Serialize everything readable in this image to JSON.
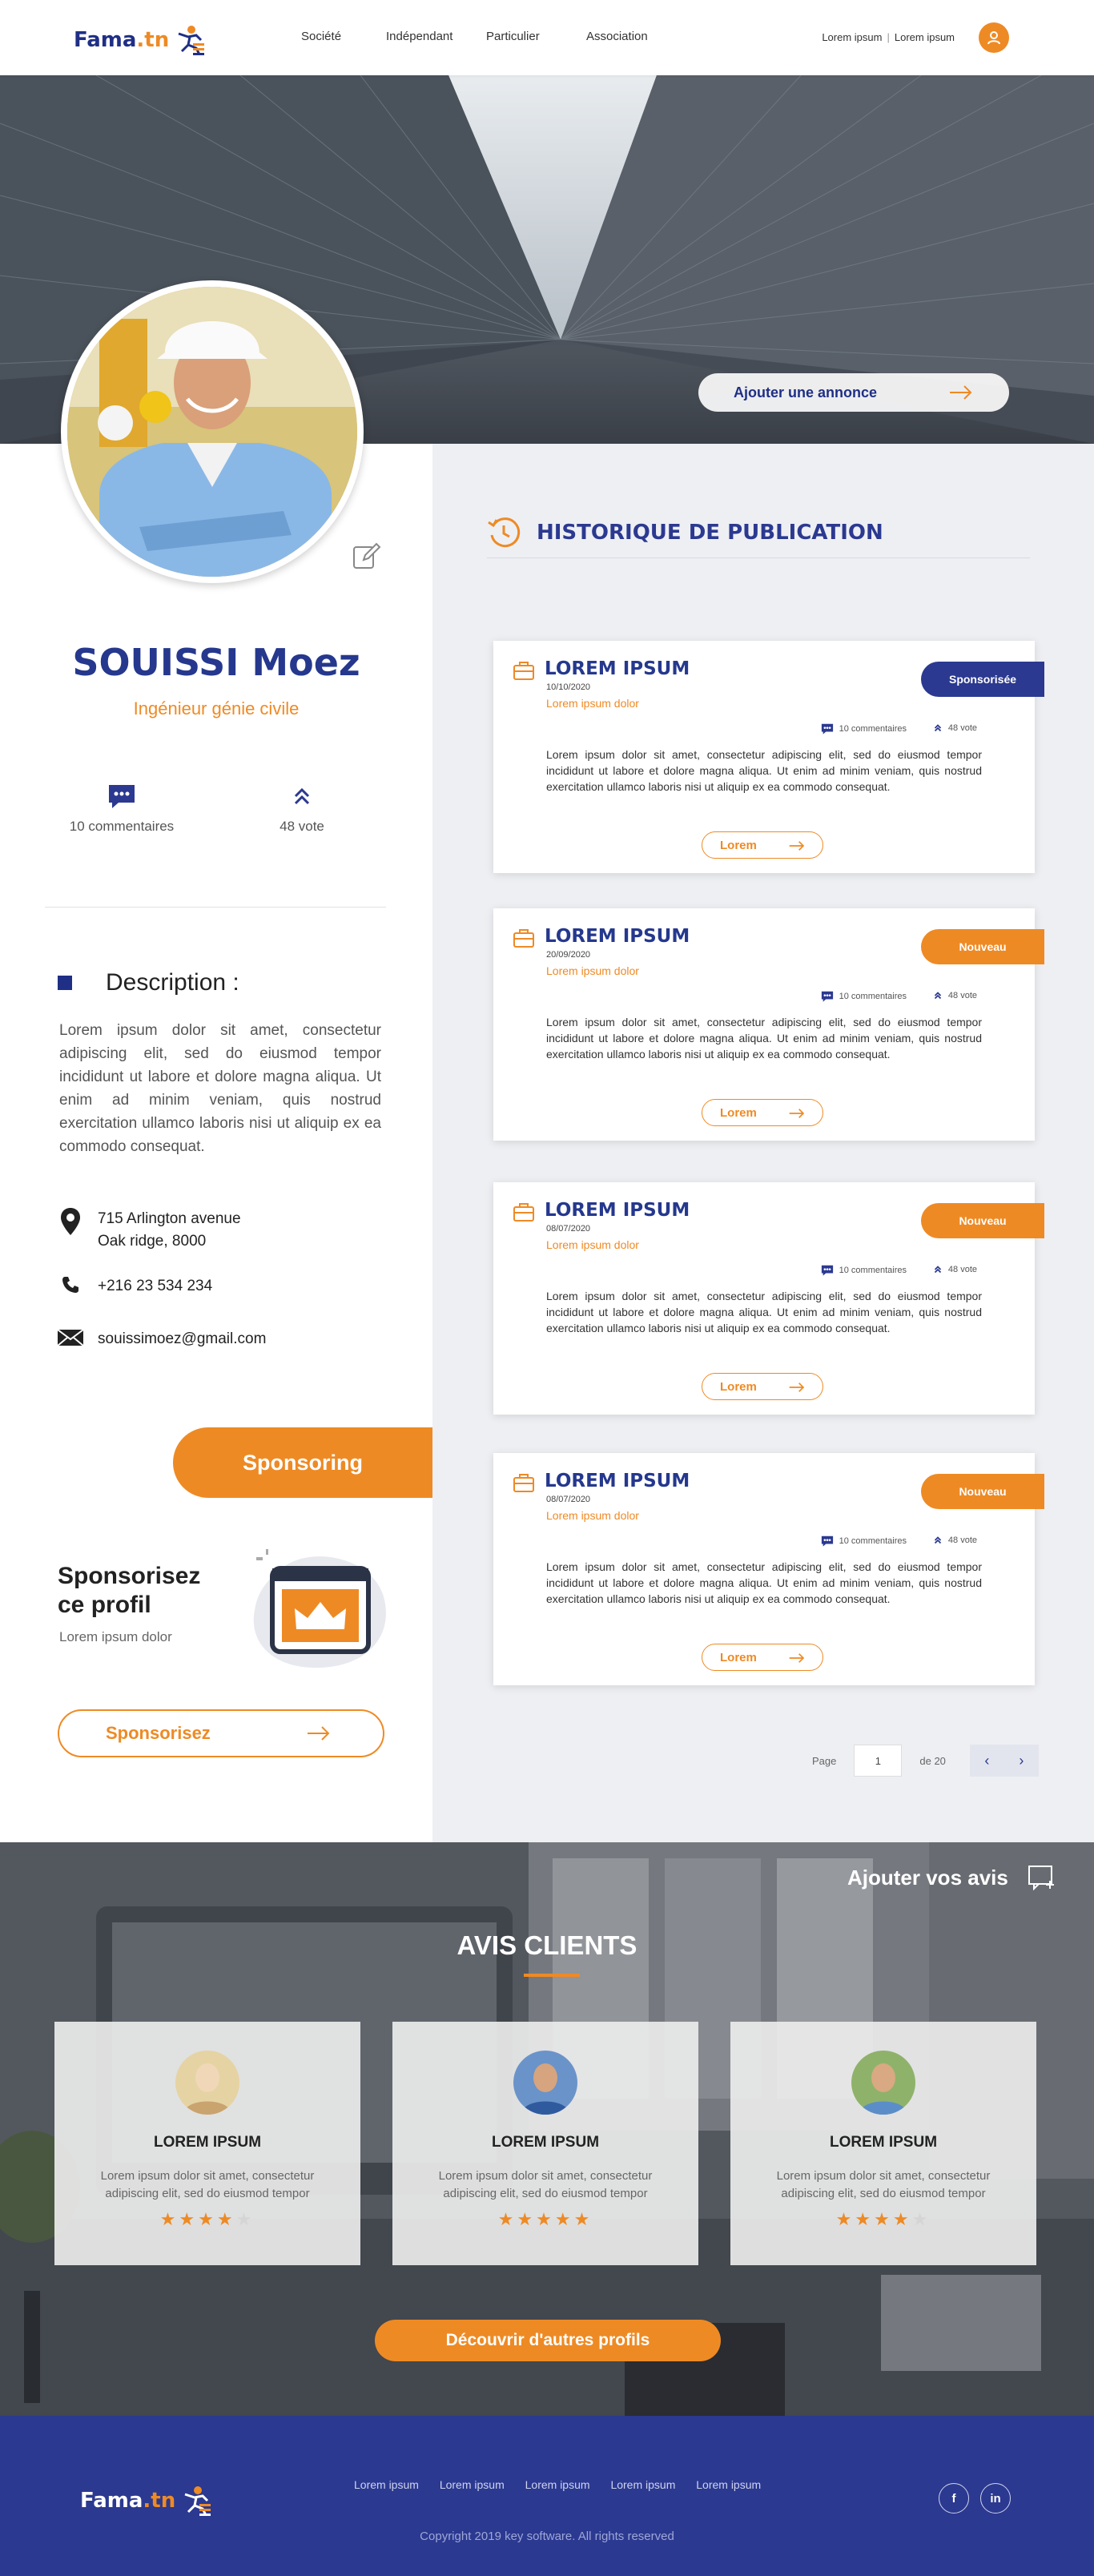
{
  "header": {
    "logo": "Fama",
    "logo_suffix": ".tn",
    "nav": [
      "Société",
      "Indépendant",
      "Particulier",
      "Association"
    ],
    "links": [
      "Lorem ipsum",
      "Lorem ipsum"
    ]
  },
  "hero": {
    "cta": "Ajouter une annonce"
  },
  "profile": {
    "name": "SOUISSI Moez",
    "job": "Ingénieur génie civile",
    "comments": "10 commentaires",
    "votes": "48 vote",
    "description_title": "Description :",
    "description": "Lorem ipsum dolor sit amet, consectetur adipiscing elit, sed do eiusmod tempor incididunt ut labore et dolore magna aliqua. Ut enim ad minim veniam, quis nostrud exercitation ullamco laboris nisi ut aliquip ex ea commodo consequat.",
    "address_line1": "715 Arlington avenue",
    "address_line2": "Oak ridge, 8000",
    "phone": "+216 23 534 234",
    "email": "souissimoez@gmail.com"
  },
  "sponsoring": {
    "tab": "Sponsoring",
    "title_line1": "Sponsorisez",
    "title_line2": "ce profil",
    "subtitle": "Lorem ipsum dolor",
    "button": "Sponsorisez"
  },
  "history": {
    "title": "HISTORIQUE DE PUBLICATION",
    "cards": [
      {
        "title": "LOREM IPSUM",
        "date": "10/10/2020",
        "subtitle": "Lorem ipsum dolor",
        "badge": "Sponsorisée",
        "badge_color": "#2b3990",
        "comments": "10 commentaires",
        "votes": "48 vote",
        "text": "Lorem ipsum dolor sit amet, consectetur adipiscing elit, sed do eiusmod tempor incididunt ut labore et dolore magna aliqua. Ut enim ad minim veniam, quis nostrud exercitation ullamco laboris nisi ut aliquip ex ea commodo consequat.",
        "button": "Lorem"
      },
      {
        "title": "LOREM IPSUM",
        "date": "20/09/2020",
        "subtitle": "Lorem ipsum dolor",
        "badge": "Nouveau",
        "badge_color": "#ee8a24",
        "comments": "10 commentaires",
        "votes": "48 vote",
        "text": "Lorem ipsum dolor sit amet, consectetur adipiscing elit, sed do eiusmod tempor incididunt ut labore et dolore magna aliqua. Ut enim ad minim veniam, quis nostrud exercitation ullamco laboris nisi ut aliquip ex ea commodo consequat.",
        "button": "Lorem"
      },
      {
        "title": "LOREM IPSUM",
        "date": "08/07/2020",
        "subtitle": "Lorem ipsum dolor",
        "badge": "Nouveau",
        "badge_color": "#ee8a24",
        "comments": "10 commentaires",
        "votes": "48 vote",
        "text": "Lorem ipsum dolor sit amet, consectetur adipiscing elit, sed do eiusmod tempor incididunt ut labore et dolore magna aliqua. Ut enim ad minim veniam, quis nostrud exercitation ullamco laboris nisi ut aliquip ex ea commodo consequat.",
        "button": "Lorem"
      },
      {
        "title": "LOREM IPSUM",
        "date": "08/07/2020",
        "subtitle": "Lorem ipsum dolor",
        "badge": "Nouveau",
        "badge_color": "#ee8a24",
        "comments": "10 commentaires",
        "votes": "48 vote",
        "text": "Lorem ipsum dolor sit amet, consectetur adipiscing elit, sed do eiusmod tempor incididunt ut labore et dolore magna aliqua. Ut enim ad minim veniam, quis nostrud exercitation ullamco laboris nisi ut aliquip ex ea commodo consequat.",
        "button": "Lorem"
      }
    ],
    "pagination": {
      "label": "Page",
      "current": "1",
      "total": "de 20"
    }
  },
  "reviews": {
    "add_label": "Ajouter vos avis",
    "title": "AVIS CLIENTS",
    "items": [
      {
        "name": "LOREM IPSUM",
        "text": "Lorem ipsum dolor sit amet, consectetur adipiscing elit, sed do eiusmod tempor",
        "rating": 4
      },
      {
        "name": "LOREM IPSUM",
        "text": "Lorem ipsum dolor sit amet, consectetur adipiscing elit, sed do eiusmod tempor",
        "rating": 5
      },
      {
        "name": "LOREM IPSUM",
        "text": "Lorem ipsum dolor sit amet, consectetur adipiscing elit, sed do eiusmod tempor",
        "rating": 4
      }
    ],
    "cta": "Découvrir d'autres profils"
  },
  "footer": {
    "logo": "Fama",
    "logo_suffix": ".tn",
    "links": [
      "Lorem ipsum",
      "Lorem ipsum",
      "Lorem ipsum",
      "Lorem ipsum",
      "Lorem ipsum"
    ],
    "social": [
      "f",
      "in"
    ],
    "copyright": "Copyright 2019 key software. All rights reserved"
  },
  "colors": {
    "primary": "#2b3990",
    "accent": "#ee8a24"
  }
}
